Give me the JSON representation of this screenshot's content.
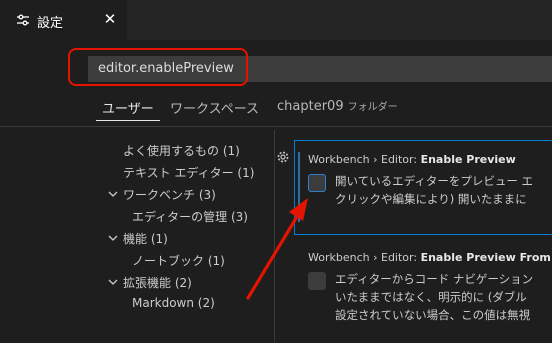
{
  "tab": {
    "title": "設定",
    "icon": "settings-icon",
    "close_label": "✕"
  },
  "search": {
    "value": "editor.enablePreview"
  },
  "scopes": [
    {
      "label": "ユーザー",
      "active": true
    },
    {
      "label": "ワークスペース",
      "active": false
    },
    {
      "label": "chapter09",
      "suffix": "フォルダー",
      "active": false
    }
  ],
  "toc": [
    {
      "label": "よく使用するもの (1)",
      "expandable": false
    },
    {
      "label": "テキスト エディター (1)",
      "expandable": false
    },
    {
      "label": "ワークベンチ (3)",
      "expandable": true
    },
    {
      "label": "エディターの管理 (3)",
      "expandable": false
    },
    {
      "label": "機能 (1)",
      "expandable": true
    },
    {
      "label": "ノートブック (1)",
      "expandable": false
    },
    {
      "label": "拡張機能 (2)",
      "expandable": true
    },
    {
      "label": "Markdown (2)",
      "expandable": false
    }
  ],
  "settings": [
    {
      "category": "Workbench › Editor: ",
      "name": "Enable Preview",
      "desc_lines": [
        "開いているエディターをプレビュー エ",
        "クリックや編集により) 開いたままに"
      ],
      "checked": false
    },
    {
      "category": "Workbench › Editor: ",
      "name": "Enable Preview From",
      "desc_lines": [
        "エディターからコード ナビゲーション",
        "いたままではなく、明示的に (ダブル",
        "設定されていない場合、この値は無視"
      ],
      "checked": false
    }
  ],
  "colors": {
    "accent": "#007fd4",
    "highlight": "#e51400",
    "background": "#1e1e1e"
  }
}
